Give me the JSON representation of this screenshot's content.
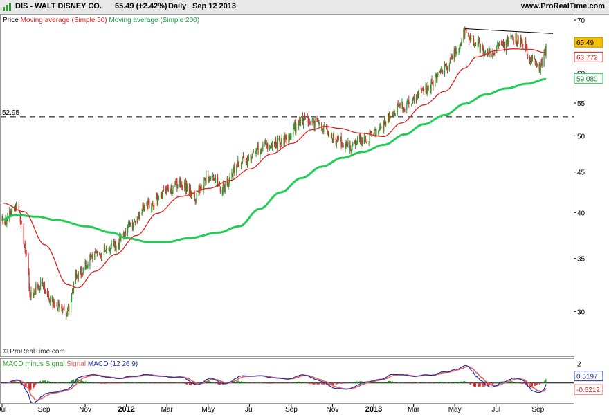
{
  "header": {
    "symbol_title": "DIS - WALT DISNEY CO.",
    "quote": "65.49 (+2.42%)",
    "period": "Daily",
    "date": "Sep 12 2013",
    "site": "www.ProRealTime.com"
  },
  "price_legend": {
    "price": "Price",
    "ma50": "Moving average (Simple 50)",
    "ma200": "Moving average (Simple 200)"
  },
  "macd_legend": {
    "hist": "MACD minus Signal",
    "signal": "Signal",
    "macd": "MACD",
    "params": "(12 26 9)"
  },
  "watermark": "© ProRealTime.com",
  "colors": {
    "up": "#2e9a2e",
    "down": "#d03030",
    "ma50": "#e02020",
    "ma200": "#22cc55",
    "macd": "#2030a0",
    "signal": "#e06060",
    "last_price_bg": "#f5c000",
    "grid": "#d8d8d8"
  },
  "chart_data": [
    {
      "type": "candlestick",
      "name": "price",
      "ylim": [
        26.5,
        71
      ],
      "y_ticks": [
        "30",
        "35",
        "40",
        "45",
        "50",
        "55",
        "60",
        "70"
      ],
      "x_ticks": [
        "Jul",
        "Sep",
        "Nov",
        "2012",
        "Mar",
        "May",
        "Jul",
        "Sep",
        "Nov",
        "2013",
        "Mar",
        "May",
        "Jul",
        "Sep"
      ],
      "price_anchors": [
        [
          "2011-07-01",
          39.2
        ],
        [
          "2011-07-22",
          40.5
        ],
        [
          "2011-08-05",
          36.0
        ],
        [
          "2011-08-10",
          31.5
        ],
        [
          "2011-08-25",
          32.5
        ],
        [
          "2011-09-20",
          30.5
        ],
        [
          "2011-10-03",
          30.0
        ],
        [
          "2011-10-20",
          33.5
        ],
        [
          "2011-11-15",
          35.5
        ],
        [
          "2011-12-15",
          36.5
        ],
        [
          "2012-01-05",
          38.5
        ],
        [
          "2012-02-01",
          41.0
        ],
        [
          "2012-03-01",
          42.5
        ],
        [
          "2012-03-20",
          43.8
        ],
        [
          "2012-04-10",
          42.0
        ],
        [
          "2012-05-01",
          44.5
        ],
        [
          "2012-05-20",
          43.0
        ],
        [
          "2012-06-20",
          46.5
        ],
        [
          "2012-07-20",
          48.5
        ],
        [
          "2012-08-20",
          49.5
        ],
        [
          "2012-09-18",
          52.5
        ],
        [
          "2012-10-10",
          52.0
        ],
        [
          "2012-11-05",
          49.5
        ],
        [
          "2012-11-20",
          48.5
        ],
        [
          "2012-12-20",
          49.8
        ],
        [
          "2013-01-10",
          51.0
        ],
        [
          "2013-01-25",
          53.5
        ],
        [
          "2013-02-20",
          55.0
        ],
        [
          "2013-03-20",
          57.5
        ],
        [
          "2013-04-15",
          61.0
        ],
        [
          "2013-05-01",
          64.0
        ],
        [
          "2013-05-15",
          67.5
        ],
        [
          "2013-06-01",
          65.5
        ],
        [
          "2013-06-20",
          63.5
        ],
        [
          "2013-07-10",
          65.0
        ],
        [
          "2013-07-25",
          66.5
        ],
        [
          "2013-08-08",
          66.0
        ],
        [
          "2013-08-20",
          62.5
        ],
        [
          "2013-09-03",
          61.5
        ],
        [
          "2013-09-11",
          63.9
        ],
        [
          "2013-09-12",
          65.49
        ]
      ],
      "ma50_anchors": [
        [
          "2011-07-01",
          41.2
        ],
        [
          "2011-08-01",
          40.2
        ],
        [
          "2011-09-01",
          36.5
        ],
        [
          "2011-10-05",
          32.5
        ],
        [
          "2011-10-20",
          32.2
        ],
        [
          "2011-11-15",
          33.8
        ],
        [
          "2011-12-15",
          35.5
        ],
        [
          "2012-01-15",
          37.5
        ],
        [
          "2012-02-15",
          40.0
        ],
        [
          "2012-03-20",
          42.0
        ],
        [
          "2012-05-01",
          43.0
        ],
        [
          "2012-06-01",
          44.0
        ],
        [
          "2012-07-01",
          45.5
        ],
        [
          "2012-08-01",
          47.5
        ],
        [
          "2012-09-01",
          49.0
        ],
        [
          "2012-10-01",
          51.0
        ],
        [
          "2012-10-20",
          51.5
        ],
        [
          "2012-11-10",
          51.2
        ],
        [
          "2012-12-10",
          50.5
        ],
        [
          "2013-01-15",
          50.0
        ],
        [
          "2013-02-10",
          52.0
        ],
        [
          "2013-03-15",
          54.8
        ],
        [
          "2013-04-15",
          57.0
        ],
        [
          "2013-05-15",
          61.0
        ],
        [
          "2013-06-01",
          63.0
        ],
        [
          "2013-07-01",
          64.2
        ],
        [
          "2013-07-25",
          64.5
        ],
        [
          "2013-08-20",
          64.4
        ],
        [
          "2013-09-12",
          63.772
        ]
      ],
      "ma200_anchors": [
        [
          "2011-07-01",
          39.3
        ],
        [
          "2011-07-20",
          39.8
        ],
        [
          "2011-08-20",
          39.6
        ],
        [
          "2011-09-20",
          39.2
        ],
        [
          "2011-11-01",
          38.5
        ],
        [
          "2011-12-10",
          37.8
        ],
        [
          "2012-01-01",
          37.2
        ],
        [
          "2012-02-01",
          36.8
        ],
        [
          "2012-03-01",
          36.8
        ],
        [
          "2012-04-01",
          37.2
        ],
        [
          "2012-05-15",
          37.8
        ],
        [
          "2012-06-15",
          38.5
        ],
        [
          "2012-07-15",
          40.5
        ],
        [
          "2012-08-15",
          42.5
        ],
        [
          "2012-09-15",
          44.3
        ],
        [
          "2012-10-15",
          45.8
        ],
        [
          "2012-11-15",
          47.0
        ],
        [
          "2012-12-15",
          47.8
        ],
        [
          "2013-01-15",
          48.8
        ],
        [
          "2013-02-15",
          50.3
        ],
        [
          "2013-03-15",
          51.8
        ],
        [
          "2013-04-15",
          53.2
        ],
        [
          "2013-05-15",
          55.0
        ],
        [
          "2013-06-15",
          56.5
        ],
        [
          "2013-07-15",
          57.5
        ],
        [
          "2013-08-15",
          58.3
        ],
        [
          "2013-09-12",
          59.08
        ]
      ],
      "horizontal_level": {
        "value": 52.95,
        "label": "52.95"
      },
      "trendline": [
        [
          "2013-05-15",
          68.4
        ],
        [
          "2013-09-12",
          67.4
        ]
      ],
      "last_values": {
        "price": "65.49",
        "ma50": "63.772",
        "ma200": "59.080"
      }
    },
    {
      "type": "macd",
      "name": "MACD (12 26 9)",
      "ylim": [
        -2.0,
        2.4
      ],
      "y_ticks": [
        "2"
      ],
      "last_values": {
        "macd": "0.5197",
        "signal": "-0.6212"
      }
    }
  ]
}
